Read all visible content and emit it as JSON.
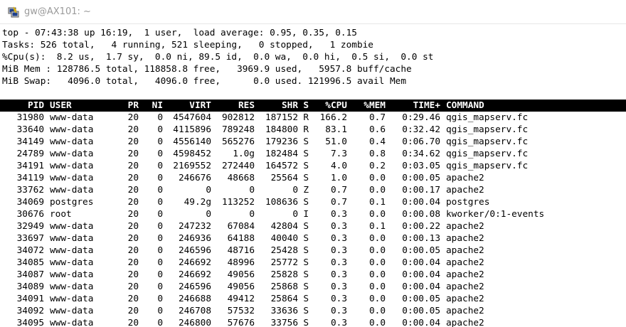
{
  "window": {
    "title": "gw@AX101: ~",
    "icon": "putty-terminal-icon"
  },
  "summary": [
    "top - 07:43:38 up 16:19,  1 user,  load average: 0.95, 0.35, 0.15",
    "Tasks: 526 total,   4 running, 521 sleeping,   0 stopped,   1 zombie",
    "%Cpu(s):  8.2 us,  1.7 sy,  0.0 ni, 89.5 id,  0.0 wa,  0.0 hi,  0.5 si,  0.0 st",
    "MiB Mem : 128786.5 total, 118858.8 free,   3969.9 used,   5957.8 buff/cache",
    "MiB Swap:   4096.0 total,   4096.0 free,      0.0 used. 121996.5 avail Mem"
  ],
  "columns": {
    "pid": "PID",
    "user": "USER",
    "pr": "PR",
    "ni": "NI",
    "virt": "VIRT",
    "res": "RES",
    "shr": "SHR",
    "s": "S",
    "cpu": "%CPU",
    "mem": "%MEM",
    "time": "TIME+",
    "command": "COMMAND"
  },
  "processes": [
    {
      "pid": "31980",
      "user": "www-data",
      "pr": "20",
      "ni": "0",
      "virt": "4547604",
      "res": "902812",
      "shr": "187152",
      "s": "R",
      "cpu": "166.2",
      "mem": "0.7",
      "time": "0:29.46",
      "command": "qgis_mapserv.fc"
    },
    {
      "pid": "33640",
      "user": "www-data",
      "pr": "20",
      "ni": "0",
      "virt": "4115896",
      "res": "789248",
      "shr": "184800",
      "s": "R",
      "cpu": "83.1",
      "mem": "0.6",
      "time": "0:32.42",
      "command": "qgis_mapserv.fc"
    },
    {
      "pid": "34149",
      "user": "www-data",
      "pr": "20",
      "ni": "0",
      "virt": "4556140",
      "res": "565276",
      "shr": "179236",
      "s": "S",
      "cpu": "51.0",
      "mem": "0.4",
      "time": "0:06.70",
      "command": "qgis_mapserv.fc"
    },
    {
      "pid": "24789",
      "user": "www-data",
      "pr": "20",
      "ni": "0",
      "virt": "4598452",
      "res": "1.0g",
      "shr": "182484",
      "s": "S",
      "cpu": "7.3",
      "mem": "0.8",
      "time": "0:34.62",
      "command": "qgis_mapserv.fc"
    },
    {
      "pid": "34191",
      "user": "www-data",
      "pr": "20",
      "ni": "0",
      "virt": "2169552",
      "res": "272440",
      "shr": "164572",
      "s": "S",
      "cpu": "4.0",
      "mem": "0.2",
      "time": "0:03.05",
      "command": "qgis_mapserv.fc"
    },
    {
      "pid": "34119",
      "user": "www-data",
      "pr": "20",
      "ni": "0",
      "virt": "246676",
      "res": "48668",
      "shr": "25564",
      "s": "S",
      "cpu": "1.0",
      "mem": "0.0",
      "time": "0:00.05",
      "command": "apache2"
    },
    {
      "pid": "33762",
      "user": "www-data",
      "pr": "20",
      "ni": "0",
      "virt": "0",
      "res": "0",
      "shr": "0",
      "s": "Z",
      "cpu": "0.7",
      "mem": "0.0",
      "time": "0:00.17",
      "command": "apache2"
    },
    {
      "pid": "34069",
      "user": "postgres",
      "pr": "20",
      "ni": "0",
      "virt": "49.2g",
      "res": "113252",
      "shr": "108636",
      "s": "S",
      "cpu": "0.7",
      "mem": "0.1",
      "time": "0:00.04",
      "command": "postgres"
    },
    {
      "pid": "30676",
      "user": "root",
      "pr": "20",
      "ni": "0",
      "virt": "0",
      "res": "0",
      "shr": "0",
      "s": "I",
      "cpu": "0.3",
      "mem": "0.0",
      "time": "0:00.08",
      "command": "kworker/0:1-events"
    },
    {
      "pid": "32949",
      "user": "www-data",
      "pr": "20",
      "ni": "0",
      "virt": "247232",
      "res": "67084",
      "shr": "42804",
      "s": "S",
      "cpu": "0.3",
      "mem": "0.1",
      "time": "0:00.22",
      "command": "apache2"
    },
    {
      "pid": "33697",
      "user": "www-data",
      "pr": "20",
      "ni": "0",
      "virt": "246936",
      "res": "64188",
      "shr": "40040",
      "s": "S",
      "cpu": "0.3",
      "mem": "0.0",
      "time": "0:00.13",
      "command": "apache2"
    },
    {
      "pid": "34072",
      "user": "www-data",
      "pr": "20",
      "ni": "0",
      "virt": "246596",
      "res": "48716",
      "shr": "25428",
      "s": "S",
      "cpu": "0.3",
      "mem": "0.0",
      "time": "0:00.05",
      "command": "apache2"
    },
    {
      "pid": "34085",
      "user": "www-data",
      "pr": "20",
      "ni": "0",
      "virt": "246692",
      "res": "48996",
      "shr": "25772",
      "s": "S",
      "cpu": "0.3",
      "mem": "0.0",
      "time": "0:00.04",
      "command": "apache2"
    },
    {
      "pid": "34087",
      "user": "www-data",
      "pr": "20",
      "ni": "0",
      "virt": "246692",
      "res": "49056",
      "shr": "25828",
      "s": "S",
      "cpu": "0.3",
      "mem": "0.0",
      "time": "0:00.04",
      "command": "apache2"
    },
    {
      "pid": "34089",
      "user": "www-data",
      "pr": "20",
      "ni": "0",
      "virt": "246596",
      "res": "49056",
      "shr": "25868",
      "s": "S",
      "cpu": "0.3",
      "mem": "0.0",
      "time": "0:00.04",
      "command": "apache2"
    },
    {
      "pid": "34091",
      "user": "www-data",
      "pr": "20",
      "ni": "0",
      "virt": "246688",
      "res": "49412",
      "shr": "25864",
      "s": "S",
      "cpu": "0.3",
      "mem": "0.0",
      "time": "0:00.05",
      "command": "apache2"
    },
    {
      "pid": "34092",
      "user": "www-data",
      "pr": "20",
      "ni": "0",
      "virt": "246708",
      "res": "57532",
      "shr": "33636",
      "s": "S",
      "cpu": "0.3",
      "mem": "0.0",
      "time": "0:00.05",
      "command": "apache2"
    },
    {
      "pid": "34095",
      "user": "www-data",
      "pr": "20",
      "ni": "0",
      "virt": "246800",
      "res": "57676",
      "shr": "33756",
      "s": "S",
      "cpu": "0.3",
      "mem": "0.0",
      "time": "0:00.04",
      "command": "apache2"
    }
  ]
}
